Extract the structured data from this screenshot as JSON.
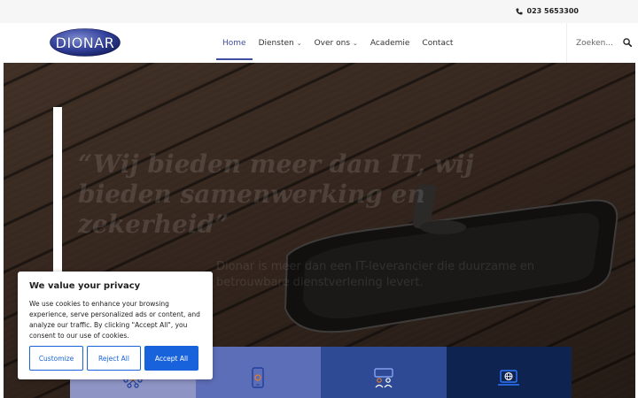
{
  "topbar": {
    "phone_number": "023 5653300",
    "phone_icon": "phone-icon"
  },
  "header": {
    "logo_text": "DIONAR",
    "nav": [
      {
        "label": "Home",
        "active": true
      },
      {
        "label": "Diensten",
        "dropdown": true
      },
      {
        "label": "Over ons",
        "dropdown": true
      },
      {
        "label": "Academie"
      },
      {
        "label": "Contact"
      }
    ],
    "search": {
      "placeholder": "Zoeken...",
      "icon": "search-icon"
    }
  },
  "hero": {
    "quote": "“Wij bieden meer dan IT, wij bieden samenwerking en zekerheid”",
    "subtitle": "Dionar is meer dan een IT-leverancier die duurzame en betrouwbare dienstverlening levert.",
    "tiles": [
      {
        "icon": "network-icon",
        "color": "#8e94c4"
      },
      {
        "icon": "mobile-security-icon",
        "color": "#5d6eb8"
      },
      {
        "icon": "support-users-icon",
        "color": "#2f4a94"
      },
      {
        "icon": "laptop-globe-icon",
        "color": "#0f2350"
      }
    ]
  },
  "cookie": {
    "title": "We value your privacy",
    "text": "We use cookies to enhance your browsing experience, serve personalized ads or content, and analyze our traffic. By clicking \"Accept All\", you consent to our use of cookies.",
    "customize_label": "Customize",
    "reject_label": "Reject All",
    "accept_label": "Accept All"
  },
  "colors": {
    "accent": "#3f4ea0",
    "cookie_button": "#1863dc"
  }
}
